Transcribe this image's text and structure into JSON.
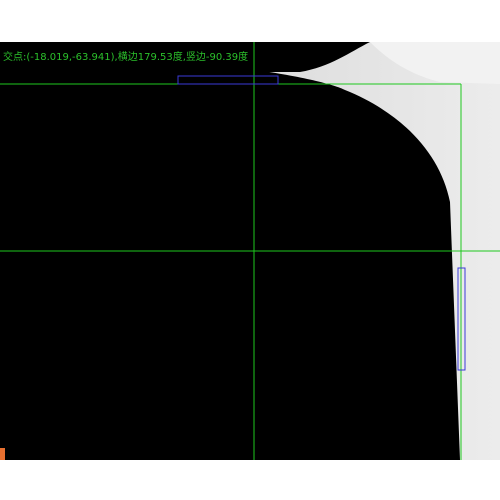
{
  "measurement": {
    "readout": "交点:(-18.019,-63.941),横边179.53度,竖边-90.39度"
  },
  "colors": {
    "crosshair": "#1ec81e",
    "roi_box": "#3a3ad8",
    "readout_text": "#2bc02b",
    "part_fill": "#000000",
    "background_light": "#dcdcdc",
    "marker": "#e87030"
  },
  "icons": {
    "corner_marker": "corner-marker-icon"
  }
}
